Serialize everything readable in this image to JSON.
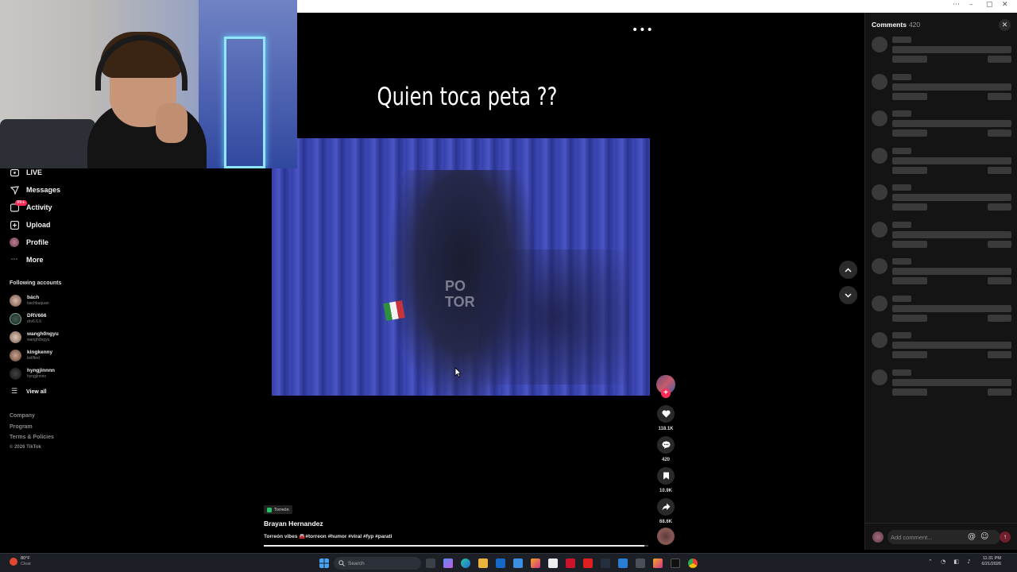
{
  "window": {
    "controls": [
      "⋯",
      "–",
      "▢",
      "✕"
    ]
  },
  "sidebar": {
    "items": [
      {
        "label": "LIVE",
        "icon": "live-icon"
      },
      {
        "label": "Messages",
        "icon": "messages-icon"
      },
      {
        "label": "Activity",
        "icon": "activity-icon",
        "badge": "99+"
      },
      {
        "label": "Upload",
        "icon": "upload-icon"
      },
      {
        "label": "Profile",
        "icon": "profile-avatar"
      },
      {
        "label": "More",
        "icon": "more-icon"
      }
    ],
    "following_title": "Following accounts",
    "accounts": [
      {
        "name": "bách",
        "user": "bachbuquan"
      },
      {
        "name": "DRV666",
        "user": "drv6.6.6"
      },
      {
        "name": "wangh0ngyu",
        "user": "wangh0ngyu"
      },
      {
        "name": "kingkenny",
        "user": "kellfted"
      },
      {
        "name": "hyngjinnnn",
        "user": "hyngjinnnn"
      }
    ],
    "view_all": "View all",
    "footer": [
      "Company",
      "Program",
      "Terms & Policies",
      "© 2026 TikTok"
    ]
  },
  "video": {
    "caption_overlay": "Quien toca peta ??",
    "location": "Torreón",
    "author": "Brayan Hernandez",
    "description": "Torreón vibes 🚘#torreon #humor #viral #fyp #parati",
    "progress": 0.99
  },
  "actions": {
    "likes": "118.1K",
    "comments": "420",
    "saves": "10.9K",
    "shares": "68.6K"
  },
  "comments_panel": {
    "title": "Comments",
    "count": "420",
    "close_symbol": "✕",
    "input_placeholder": "Add comment...",
    "at_symbol": "@",
    "emoji_symbol": "☺",
    "send_symbol": "↑"
  },
  "taskbar": {
    "weather_temp": "80°F",
    "weather_desc": "Clear",
    "search_placeholder": "Search",
    "time": "11:31 PM",
    "date": "6/21/2026"
  },
  "colors": {
    "accent": "#fe2c55",
    "background": "#000000",
    "panel": "#141414"
  }
}
